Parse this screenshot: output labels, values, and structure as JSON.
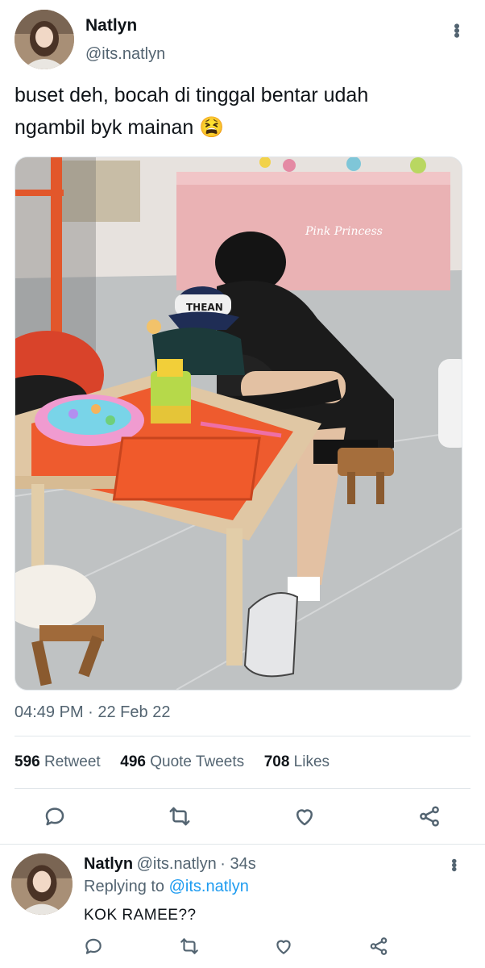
{
  "tweet": {
    "author_name": "Natlyn",
    "author_handle": "@its.natlyn",
    "text_line1": "buset deh, bocah di tinggal bentar udah",
    "text_line2": "ngambil byk mainan 😫",
    "timestamp": "04:49 PM · 22 Feb 22",
    "retweet_count": "596",
    "retweet_label": "Retweet",
    "quote_count": "496",
    "quote_label": "Quote Tweets",
    "like_count": "708",
    "like_label": "Likes",
    "photo_banner_text": "Pink Princess",
    "hat_text": "THEAN"
  },
  "reply": {
    "author_name": "Natlyn",
    "author_handle": "@its.natlyn",
    "time": "· 34s",
    "replying_prefix": "Replying to",
    "replying_handle": "@its.natlyn",
    "text": "KOK RAMEE??"
  },
  "icons": {
    "more": "more-vertical-icon",
    "reply": "reply-icon",
    "retweet": "retweet-icon",
    "like": "heart-icon",
    "share": "share-icon"
  }
}
